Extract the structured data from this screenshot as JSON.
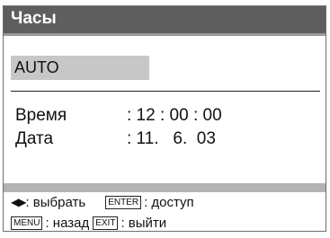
{
  "menu": {
    "title": "Часы",
    "mode_value": "AUTO"
  },
  "fields": {
    "time": {
      "label": "Время",
      "value": ": 12 : 00 : 00"
    },
    "date": {
      "label": "Дата",
      "value": ": 11.   6.  03"
    }
  },
  "help": {
    "arrows_icon": "left-right-arrows-icon",
    "arrows_glyph": "◀▶",
    "select_text": ": выбрать",
    "enter_key": "ENTER",
    "enter_text": ": доступ",
    "menu_key": "MENU",
    "menu_text": ": назад",
    "exit_key": "EXIT",
    "exit_text": ": выйти"
  },
  "colors": {
    "title_bar": "#5e5e5e",
    "mode_highlight": "#c7c7c7",
    "separator": "#b3b3b3"
  }
}
